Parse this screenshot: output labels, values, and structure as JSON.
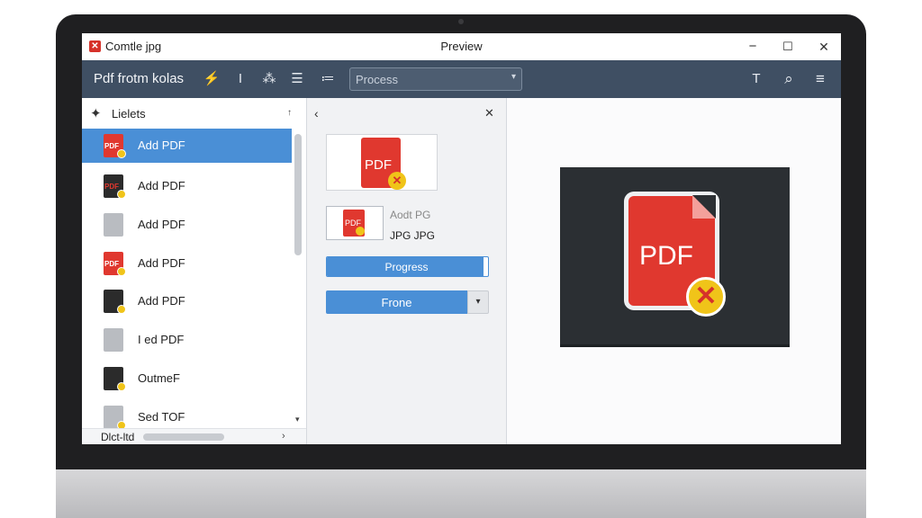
{
  "window": {
    "file_title": "Comtle jpg",
    "title": "Preview",
    "controls": {
      "minimize": "−",
      "maximize": "☐",
      "close": "✕"
    }
  },
  "toolbar": {
    "title": "Pdf frotm kolas",
    "icons": [
      "bolt-icon",
      "text-cursor-icon",
      "magic-wand-icon",
      "list-icon",
      "bullet-list-icon",
      "text-icon",
      "search-icon",
      "menu-icon"
    ],
    "icon_glyphs": {
      "bolt": "⚡",
      "cursor": "I",
      "wand": "⁂",
      "list": "☰",
      "bullets": "≔",
      "text": "T",
      "search": "⌕",
      "menu": "≡"
    },
    "dropdown": {
      "value": "Process",
      "caret": "▾"
    }
  },
  "sidebar": {
    "header": {
      "icon": "✦",
      "label": "Lielets",
      "sort_glyph": "↑"
    },
    "items": [
      {
        "label": "Add PDF",
        "icon": "pdf-file-icon",
        "icon_text": "PDF",
        "selected": true
      },
      {
        "label": "Add PDF",
        "icon": "dark-file-icon",
        "icon_text": "PDF",
        "selected": false
      },
      {
        "label": "Add PDF",
        "icon": "gray-file-icon",
        "icon_text": "",
        "selected": false
      },
      {
        "label": "Add PDF",
        "icon": "pdf-file-icon",
        "icon_text": "PDF",
        "selected": false
      },
      {
        "label": "Add PDF",
        "icon": "dark-file-icon",
        "icon_text": "",
        "selected": false
      },
      {
        "label": "I ed PDF",
        "icon": "gray-file-icon",
        "icon_text": "",
        "selected": false
      },
      {
        "label": "OutmeF",
        "icon": "dark-file-icon",
        "icon_text": "",
        "selected": false
      },
      {
        "label": "Sed TOF",
        "icon": "gray-file-icon",
        "icon_text": "",
        "selected": false
      }
    ],
    "footer": {
      "label": "Dlct-ltd",
      "scroll_right": "›",
      "scroll_down": "▾"
    }
  },
  "middle": {
    "back": "‹",
    "close": "✕",
    "large_thumb": {
      "text": "PDF",
      "badge": "✕"
    },
    "small_thumb": {
      "text": "PDF",
      "caption1": "Aodt PG",
      "caption2": "JPG JPG"
    },
    "progress": {
      "label": "Progress",
      "value": 0.97
    },
    "select": {
      "value": "Frone",
      "caret": "▾"
    }
  },
  "preview": {
    "file": {
      "text": "PDF",
      "badge": "✕"
    }
  },
  "colors": {
    "toolbar": "#3f4f63",
    "accent": "#4a8fd6",
    "pdf_red": "#e0382f",
    "badge_yellow": "#f0c419"
  }
}
